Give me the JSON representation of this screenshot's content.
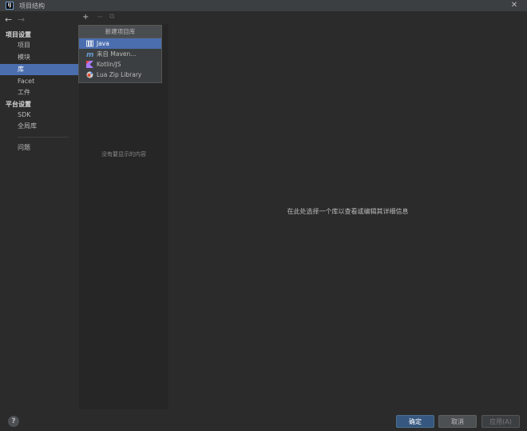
{
  "window": {
    "title": "项目结构",
    "app_icon_text": "IJ"
  },
  "nav": {
    "back": "←",
    "forward": "→"
  },
  "sidebar": {
    "project_settings_header": "项目设置",
    "items": [
      {
        "label": "项目"
      },
      {
        "label": "模块"
      },
      {
        "label": "库"
      },
      {
        "label": "Facet"
      },
      {
        "label": "工件"
      }
    ],
    "platform_settings_header": "平台设置",
    "platform_items": [
      {
        "label": "SDK"
      },
      {
        "label": "全局库"
      }
    ],
    "problems": "问题"
  },
  "toolbar": {
    "add": "+",
    "remove": "−",
    "copy": "⧉"
  },
  "library_list": {
    "empty_text": "没有要显示的内容"
  },
  "popup": {
    "title": "新建项目库",
    "items": [
      {
        "label": "Java",
        "icon": "java-library-icon"
      },
      {
        "label": "来自 Maven...",
        "icon": "maven-icon"
      },
      {
        "label": "Kotlin/JS",
        "icon": "kotlin-icon"
      },
      {
        "label": "Lua Zip Library",
        "icon": "lua-icon"
      }
    ]
  },
  "main": {
    "hint": "在此处选择一个库以查看或编辑其详细信息"
  },
  "footer": {
    "help": "?",
    "ok": "确定",
    "cancel": "取消",
    "apply": "应用(A)"
  },
  "colors": {
    "background": "#2b2b2b",
    "selection": "#4b6eaf",
    "primary_button": "#365880"
  }
}
